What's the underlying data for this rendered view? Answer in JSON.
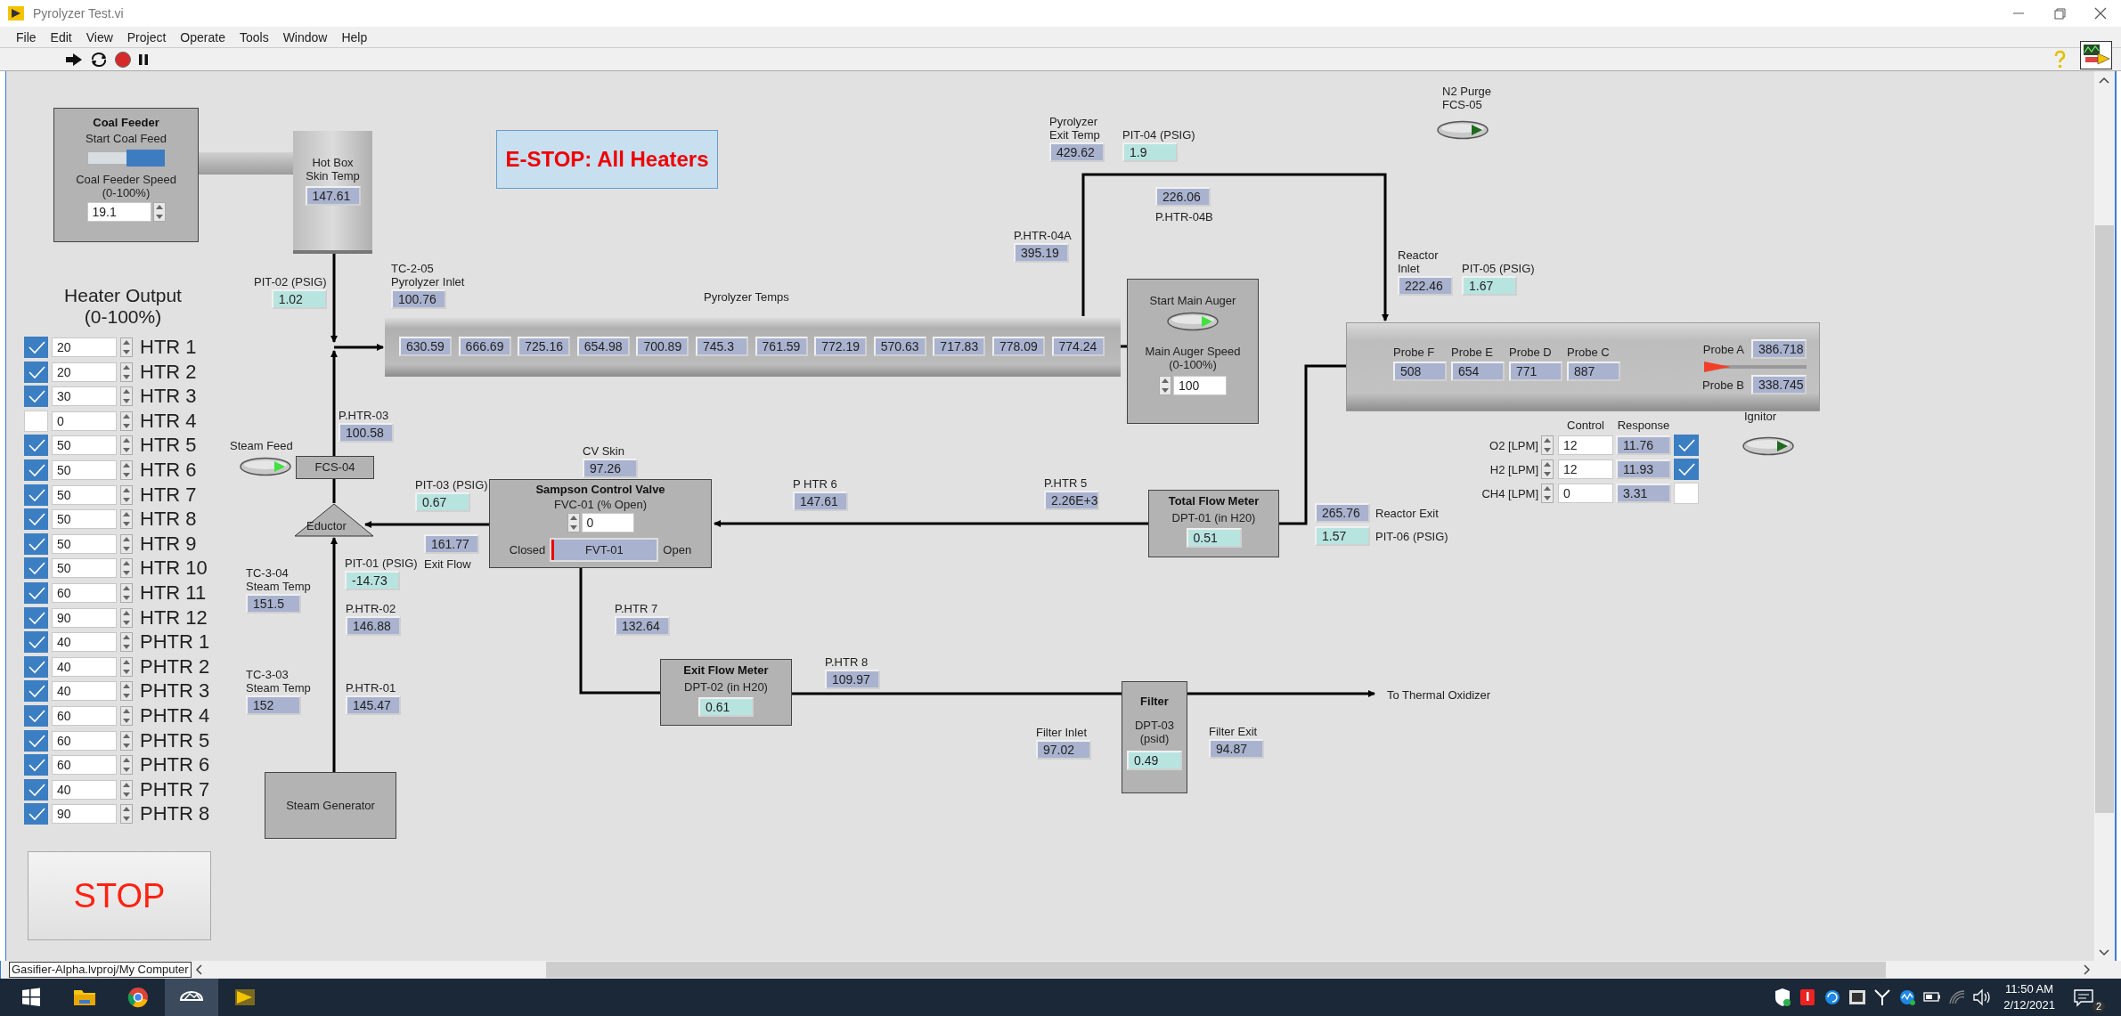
{
  "window": {
    "title": "Pyrolyzer Test.vi"
  },
  "menu": [
    {
      "label": "File"
    },
    {
      "label": "Edit"
    },
    {
      "label": "View"
    },
    {
      "label": "Project"
    },
    {
      "label": "Operate"
    },
    {
      "label": "Tools"
    },
    {
      "label": "Window"
    },
    {
      "label": "Help"
    }
  ],
  "panel": {
    "coal_feeder": {
      "title": "Coal Feeder",
      "switch_label": "Start Coal Feed",
      "running": true,
      "speed_label": "Coal Feeder Speed\n(0-100%)",
      "speed": "19.1"
    },
    "hot_box": {
      "label": "Hot Box\nSkin Temp",
      "value": "147.61"
    },
    "estop": {
      "label": "E-STOP: All Heaters"
    },
    "heater_output": {
      "title": "Heater Output\n(0-100%)",
      "heaters": [
        {
          "name": "HTR 1",
          "value": "20",
          "enabled": true
        },
        {
          "name": "HTR 2",
          "value": "20",
          "enabled": true
        },
        {
          "name": "HTR 3",
          "value": "30",
          "enabled": true
        },
        {
          "name": "HTR 4",
          "value": "0",
          "enabled": false
        },
        {
          "name": "HTR 5",
          "value": "50",
          "enabled": true
        },
        {
          "name": "HTR 6",
          "value": "50",
          "enabled": true
        },
        {
          "name": "HTR 7",
          "value": "50",
          "enabled": true
        },
        {
          "name": "HTR 8",
          "value": "50",
          "enabled": true
        },
        {
          "name": "HTR 9",
          "value": "50",
          "enabled": true
        },
        {
          "name": "HTR 10",
          "value": "50",
          "enabled": true
        },
        {
          "name": "HTR 11",
          "value": "60",
          "enabled": true
        },
        {
          "name": "HTR 12",
          "value": "90",
          "enabled": true
        },
        {
          "name": "PHTR 1",
          "value": "40",
          "enabled": true
        },
        {
          "name": "PHTR 2",
          "value": "40",
          "enabled": true
        },
        {
          "name": "PHTR 3",
          "value": "40",
          "enabled": true
        },
        {
          "name": "PHTR 4",
          "value": "60",
          "enabled": true
        },
        {
          "name": "PHTR 5",
          "value": "60",
          "enabled": true
        },
        {
          "name": "PHTR 6",
          "value": "60",
          "enabled": true
        },
        {
          "name": "PHTR 7",
          "value": "40",
          "enabled": true
        },
        {
          "name": "PHTR 8",
          "value": "90",
          "enabled": true
        }
      ]
    },
    "stop": {
      "label": "STOP"
    },
    "pyrolyzer_temps": {
      "label": "Pyrolyzer Temps",
      "values": [
        "630.59",
        "666.69",
        "725.16",
        "654.98",
        "700.89",
        "745.3",
        "761.59",
        "772.19",
        "570.63",
        "717.83",
        "778.09",
        "774.24"
      ]
    },
    "main_auger": {
      "switch_label": "Start Main Auger",
      "on": true,
      "speed_label": "Main Auger Speed\n(0-100%)",
      "speed": "100"
    },
    "steam_feed": {
      "label": "Steam Feed",
      "on": true
    },
    "fcs": {
      "label": "FCS-04"
    },
    "eductor": {
      "label": "Eductor"
    },
    "steam_generator": {
      "label": "Steam Generator"
    },
    "valve": {
      "title": "Sampson Control Valve",
      "control_label": "FVC-01 (% Open)",
      "setpoint": "0",
      "closed_label": "Closed",
      "gauge_label": "FVT-01",
      "open_label": "Open",
      "level": 0
    },
    "total_flow_meter": {
      "title": "Total Flow Meter",
      "label": "DPT-01 (in H20)",
      "value": "0.51"
    },
    "exit_flow_meter": {
      "title": "Exit Flow Meter",
      "label": "DPT-02 (in H20)",
      "value": "0.61"
    },
    "filter": {
      "title": "Filter",
      "label": "DPT-03\n(psid)",
      "value": "0.49"
    },
    "destination": "To Thermal Oxidizer",
    "n2_purge": {
      "label": "N2 Purge\nFCS-05",
      "on": false
    },
    "reactor": {
      "probes": [
        {
          "label": "Probe F",
          "value": "508"
        },
        {
          "label": "Probe E",
          "value": "654"
        },
        {
          "label": "Probe D",
          "value": "771"
        },
        {
          "label": "Probe C",
          "value": "887"
        }
      ],
      "probe_a": {
        "label": "Probe A",
        "value": "386.718"
      },
      "probe_b": {
        "label": "Probe B",
        "value": "338.745"
      },
      "level": 0
    },
    "gas_flows": {
      "columns": [
        "Control",
        "Response"
      ],
      "rows": [
        {
          "name": "O2 [LPM]",
          "control": "12",
          "response": "11.76",
          "checked": true
        },
        {
          "name": "H2 [LPM]",
          "control": "12",
          "response": "11.93",
          "checked": true
        },
        {
          "name": "CH4 [LPM]",
          "control": "0",
          "response": "3.31",
          "checked": false
        }
      ]
    },
    "ignitor": {
      "label": "Ignitor",
      "on": false
    },
    "indicators": [
      {
        "label": "PIT-02 (PSIG)",
        "value": "1.02",
        "kind": "pressure"
      },
      {
        "label": "TC-2-05\nPyrolyzer Inlet",
        "value": "100.76",
        "kind": "temperature"
      },
      {
        "label": "Pyrolyzer\nExit Temp",
        "value": "429.62",
        "kind": "temperature"
      },
      {
        "label": "PIT-04 (PSIG)",
        "value": "1.9",
        "kind": "pressure"
      },
      {
        "label": "P.HTR-04B",
        "value": "226.06",
        "kind": "temperature"
      },
      {
        "label": "P.HTR-04A",
        "value": "395.19",
        "kind": "temperature"
      },
      {
        "label": "Reactor\nInlet",
        "value": "222.46",
        "kind": "temperature"
      },
      {
        "label": "PIT-05 (PSIG)",
        "value": "1.67",
        "kind": "pressure"
      },
      {
        "label": "P.HTR-03",
        "value": "100.58",
        "kind": "temperature"
      },
      {
        "label": "CV Skin",
        "value": "97.26",
        "kind": "temperature"
      },
      {
        "label": "PIT-03 (PSIG)",
        "value": "0.67",
        "kind": "pressure"
      },
      {
        "label": "Exit Flow",
        "value": "161.77",
        "kind": "temperature"
      },
      {
        "label": "PIT-01 (PSIG)",
        "value": "-14.73",
        "kind": "pressure"
      },
      {
        "label": "TC-3-04\nSteam Temp",
        "value": "151.5",
        "kind": "temperature"
      },
      {
        "label": "P.HTR-02",
        "value": "146.88",
        "kind": "temperature"
      },
      {
        "label": "TC-3-03\nSteam Temp",
        "value": "152",
        "kind": "temperature"
      },
      {
        "label": "P.HTR-01",
        "value": "145.47",
        "kind": "temperature"
      },
      {
        "label": "P HTR 6",
        "value": "147.61",
        "kind": "temperature"
      },
      {
        "label": "P.HTR 5",
        "value": "2.26E+3",
        "kind": "temperature"
      },
      {
        "label": "Reactor Exit",
        "value": "265.76",
        "kind": "temperature"
      },
      {
        "label": "PIT-06 (PSIG)",
        "value": "1.57",
        "kind": "pressure"
      },
      {
        "label": "P.HTR 7",
        "value": "132.64",
        "kind": "temperature"
      },
      {
        "label": "P.HTR 8",
        "value": "109.97",
        "kind": "temperature"
      },
      {
        "label": "Filter Inlet",
        "value": "97.02",
        "kind": "temperature"
      },
      {
        "label": "Filter Exit",
        "value": "94.87",
        "kind": "temperature"
      }
    ]
  },
  "status_bar": {
    "path": "Gasifier-Alpha.lvproj/My Computer"
  },
  "taskbar": {
    "time": "11:50 AM",
    "date": "2/12/2021",
    "notifications": "2"
  }
}
